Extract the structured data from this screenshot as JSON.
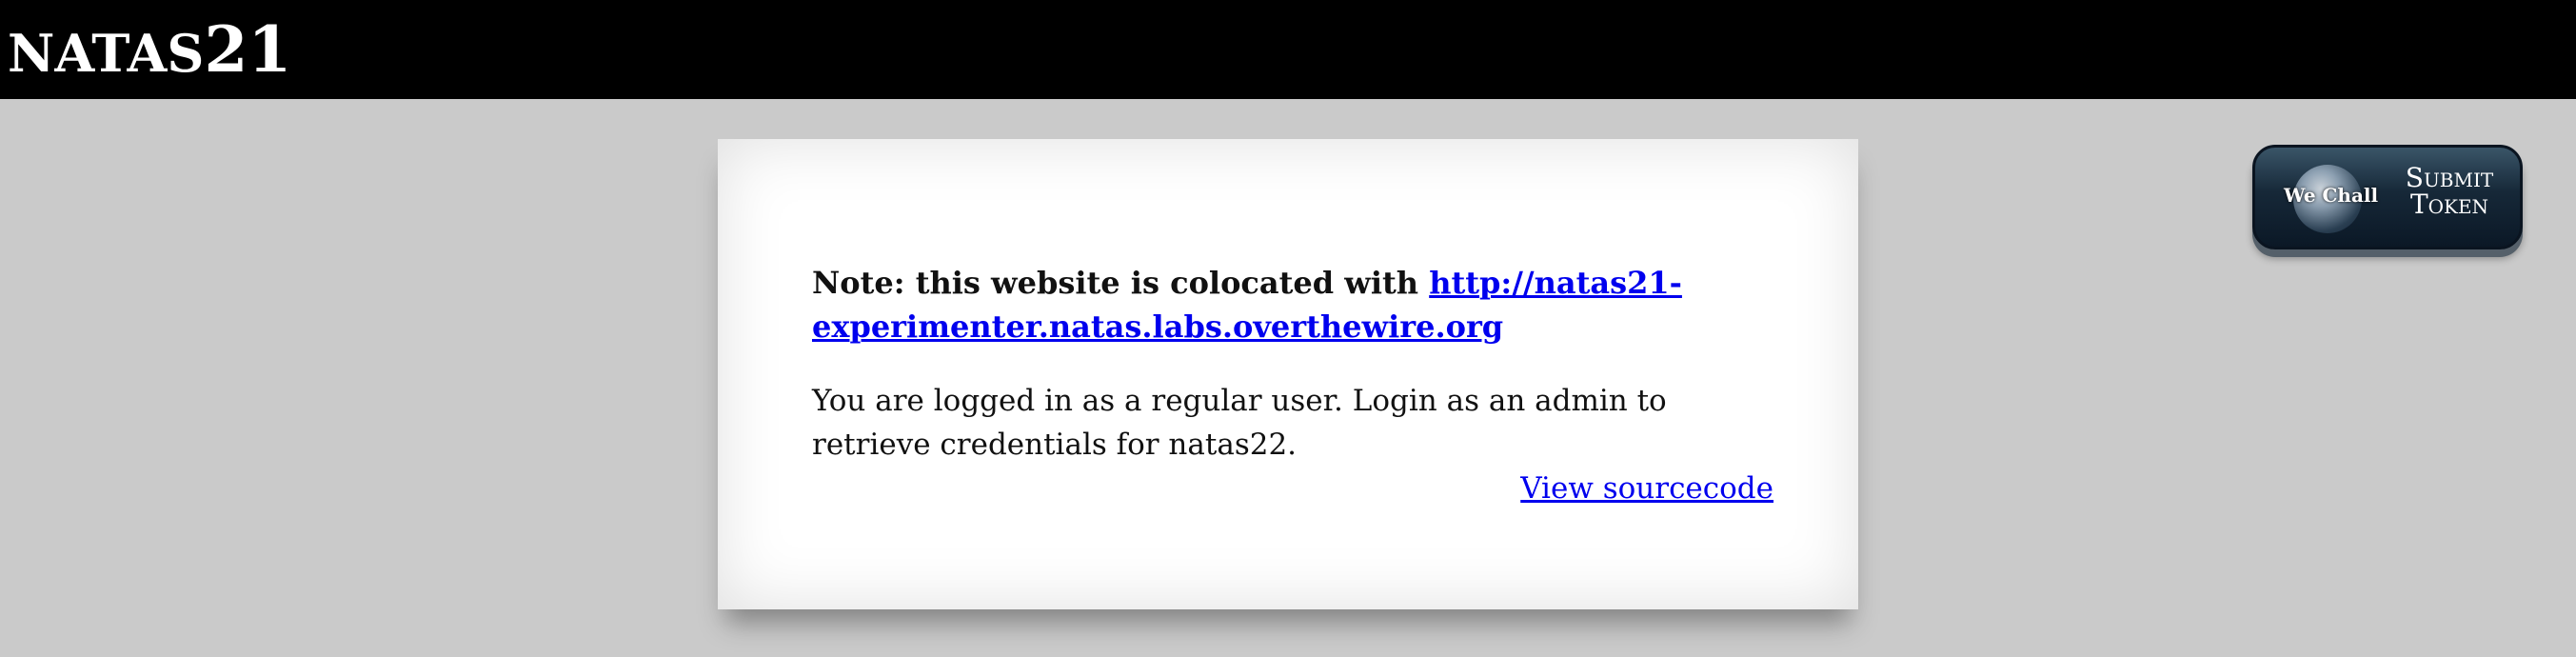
{
  "header": {
    "title_prefix": "NATAS",
    "title_number": "21",
    "background_color": "#000000",
    "text_color": "#ffffff"
  },
  "panel": {
    "note_label": "Note: this website is colocated with ",
    "note_link_text": "http://natas21-experimenter.natas.labs.overthewire.org",
    "message": "You are logged in as a regular user. Login as an admin to retrieve credentials for natas22.",
    "view_source_label": "View sourcecode"
  },
  "wechall": {
    "logo_text": "We Chall",
    "submit_line1": "Submit",
    "submit_line2": "Token"
  },
  "colors": {
    "page_background": "#cacaca",
    "link": "#0000ee",
    "button_dark": "#0b1826"
  }
}
